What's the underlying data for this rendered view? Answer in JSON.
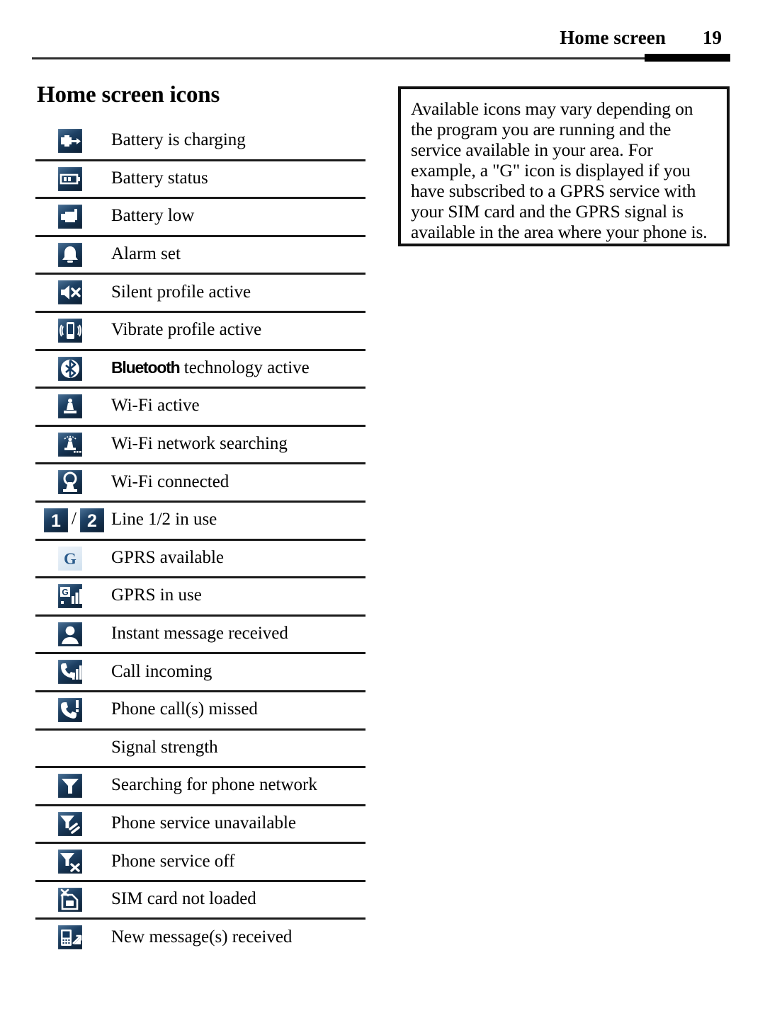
{
  "header": {
    "title": "Home screen",
    "page_number": "19"
  },
  "section": {
    "heading": "Home screen icons"
  },
  "note": {
    "text": "Available icons may vary depending on the program you are running and the service available in your area. For example, a \"G\" icon is displayed if you have subscribed to a GPRS service with your SIM card and the GPRS signal is available in the area where your phone is."
  },
  "icon_table": {
    "rows": [
      {
        "icon": "battery-charging-icon",
        "label": "Battery is charging"
      },
      {
        "icon": "battery-status-icon",
        "label": "Battery status"
      },
      {
        "icon": "battery-low-icon",
        "label": "Battery low"
      },
      {
        "icon": "alarm-bell-icon",
        "label": "Alarm set"
      },
      {
        "icon": "speaker-muted-icon",
        "label": "Silent profile active"
      },
      {
        "icon": "vibrate-icon",
        "label": "Vibrate profile active"
      },
      {
        "icon": "bluetooth-icon",
        "label": "Bluetooth technology active",
        "label_bold_prefix": "Bluetooth",
        "label_rest": " technology active"
      },
      {
        "icon": "wifi-active-icon",
        "label": "Wi-Fi active"
      },
      {
        "icon": "wifi-searching-icon",
        "label": "Wi-Fi network searching"
      },
      {
        "icon": "wifi-connected-icon",
        "label": "Wi-Fi connected"
      },
      {
        "icon": "line-one-two-icon",
        "label": "Line 1/2 in use",
        "icon_text_1": "1",
        "icon_text_2": "2",
        "separator": "/"
      },
      {
        "icon": "gprs-available-icon",
        "label": "GPRS available",
        "icon_text": "G"
      },
      {
        "icon": "gprs-in-use-icon",
        "label": "GPRS in use",
        "icon_text": "G"
      },
      {
        "icon": "instant-message-icon",
        "label": "Instant message received"
      },
      {
        "icon": "call-incoming-icon",
        "label": "Call incoming"
      },
      {
        "icon": "call-missed-icon",
        "label": "Phone call(s) missed"
      },
      {
        "icon": "none",
        "label": "Signal strength"
      },
      {
        "icon": "network-searching-icon",
        "label": "Searching for phone network"
      },
      {
        "icon": "service-unavailable-icon",
        "label": "Phone service unavailable"
      },
      {
        "icon": "service-off-icon",
        "label": "Phone service off"
      },
      {
        "icon": "sim-not-loaded-icon",
        "label": "SIM card not loaded"
      },
      {
        "icon": "new-message-icon",
        "label": "New message(s) received"
      }
    ]
  },
  "colors": {
    "icon_background_dark": "#12304f",
    "icon_glyph": "#ffffff",
    "rule": "#1a1a1a",
    "text": "#000000"
  }
}
